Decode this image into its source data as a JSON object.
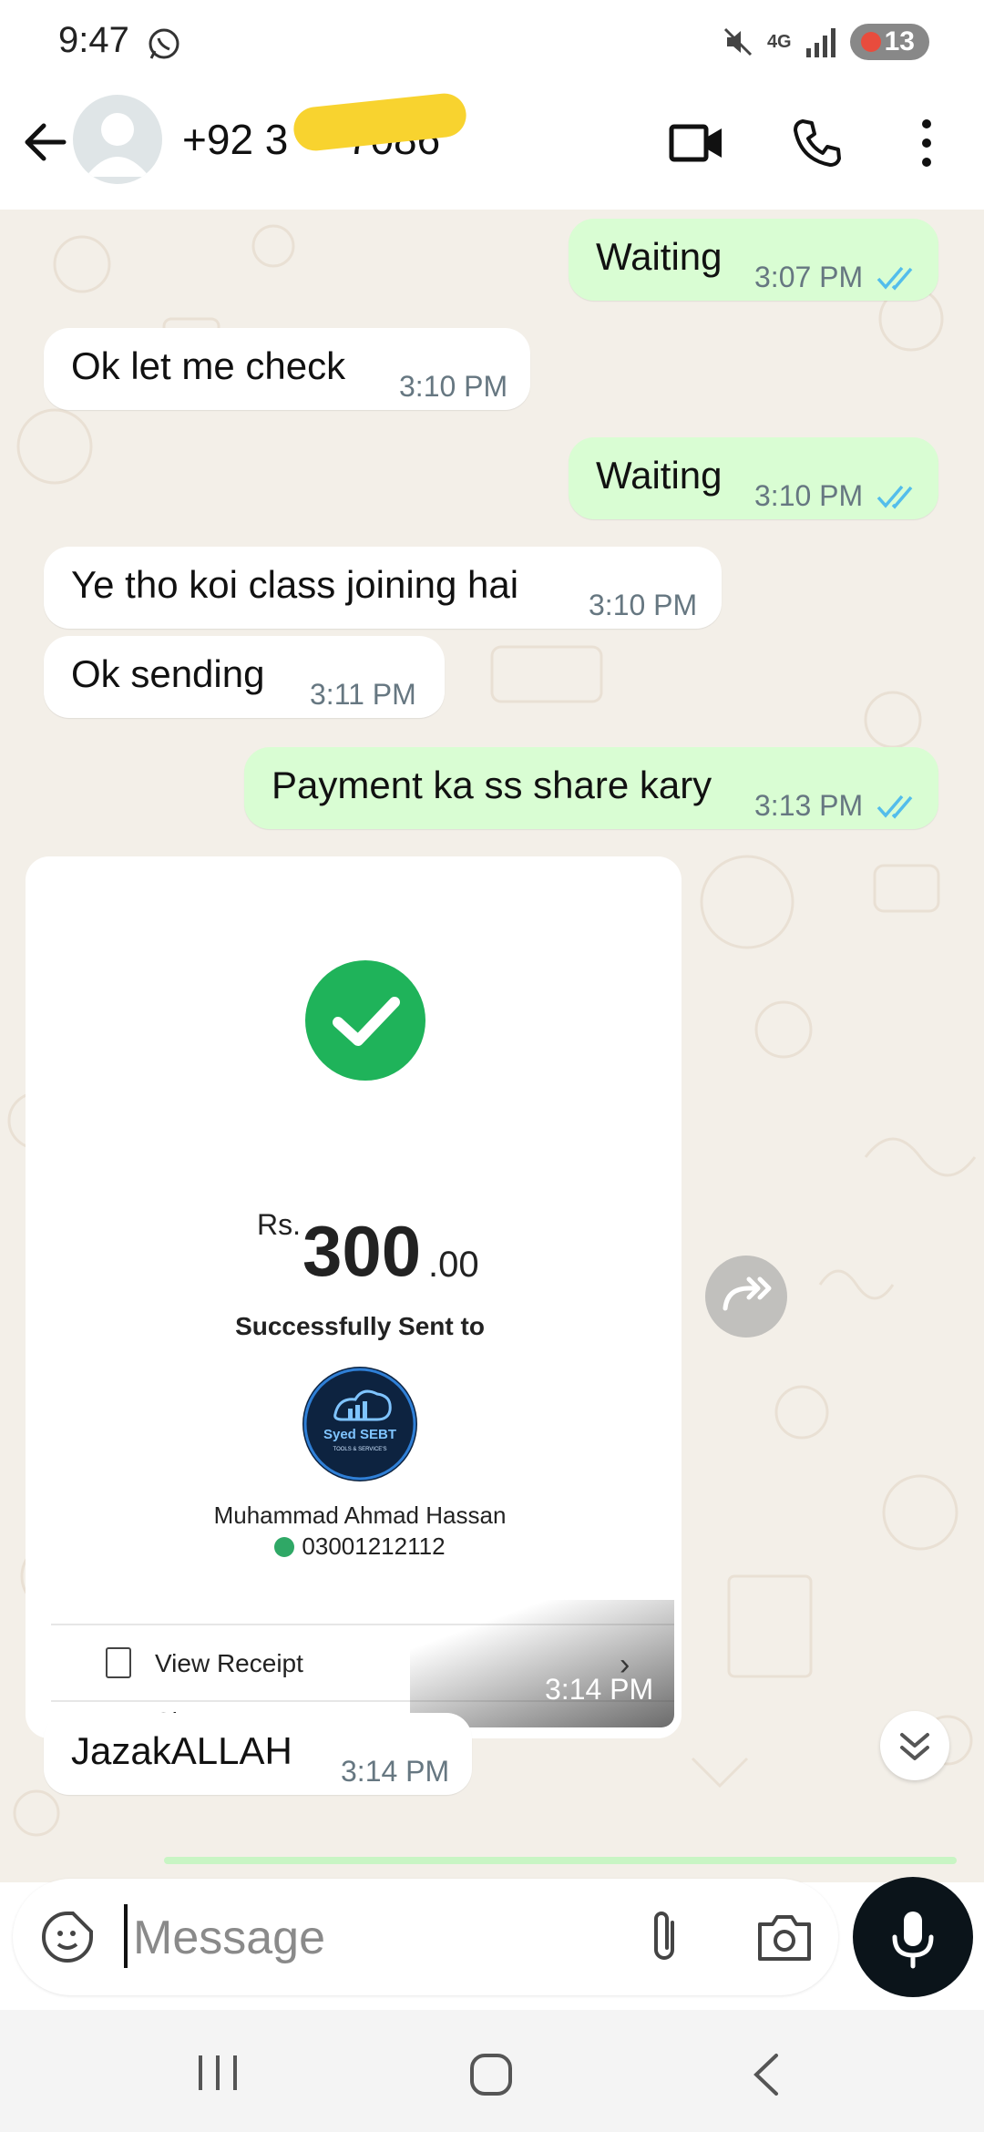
{
  "status_bar": {
    "time": "9:47",
    "network": "4G",
    "battery": "13"
  },
  "header": {
    "contact_name": "+92 3       7086"
  },
  "messages": [
    {
      "text": "Waiting",
      "time": "3:07 PM"
    },
    {
      "text": "Ok let me check",
      "time": "3:10 PM"
    },
    {
      "text": "Waiting",
      "time": "3:10 PM"
    },
    {
      "text": "Ye tho koi class joining hai",
      "time": "3:10 PM"
    },
    {
      "text": "Ok sending",
      "time": "3:11 PM"
    },
    {
      "text": "Payment ka ss share kary",
      "time": "3:13 PM"
    },
    {
      "text": "JazakALLAH",
      "time": "3:14 PM"
    }
  ],
  "payment": {
    "currency": "Rs.",
    "amount": "300",
    "decimals": ".00",
    "status": "Successfully Sent to",
    "logo_title": "Syed SEBT",
    "logo_subtitle": "TOOLS & SERVICE'S",
    "recipient": "Muhammad Ahmad Hassan",
    "phone": "03001212112",
    "view_receipt": "View Receipt",
    "share": "Share",
    "time": "3:14 PM"
  },
  "input": {
    "placeholder": "Message"
  },
  "colors": {
    "outgoing": "#d9fdd3",
    "incoming": "#ffffff",
    "wallpaper": "#f3efe8",
    "read_ticks": "#53bdeb",
    "success": "#1fb35a"
  }
}
